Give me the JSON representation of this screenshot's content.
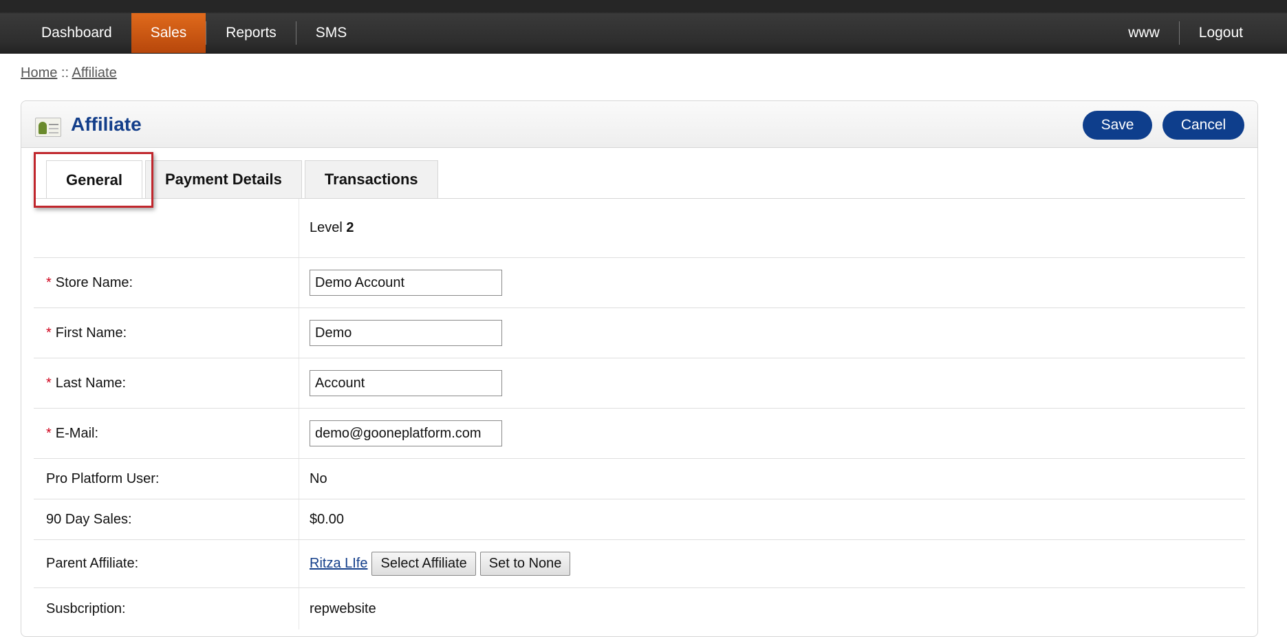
{
  "nav": {
    "left": [
      {
        "label": "Dashboard",
        "active": false
      },
      {
        "label": "Sales",
        "active": true
      },
      {
        "label": "Reports",
        "active": false
      },
      {
        "label": "SMS",
        "active": false
      }
    ],
    "right": [
      {
        "label": "www"
      },
      {
        "label": "Logout"
      }
    ],
    "active_color": "#d45a14"
  },
  "breadcrumb": {
    "home": "Home",
    "separator": "::",
    "current": "Affiliate"
  },
  "panel": {
    "icon": "id-card-icon",
    "title": "Affiliate",
    "save_label": "Save",
    "cancel_label": "Cancel",
    "primary_color": "#0e3e8c"
  },
  "tabs": [
    {
      "label": "General",
      "active": true
    },
    {
      "label": "Payment Details",
      "active": false
    },
    {
      "label": "Transactions",
      "active": false
    }
  ],
  "form": {
    "level_label": "Level",
    "level_value": "2",
    "required_mark": "*",
    "store_name": {
      "label": "Store Name:",
      "value": "Demo Account"
    },
    "first_name": {
      "label": "First Name:",
      "value": "Demo"
    },
    "last_name": {
      "label": "Last Name:",
      "value": "Account"
    },
    "email": {
      "label": "E-Mail:",
      "value": "demo@gooneplatform.com"
    },
    "pro_user": {
      "label": "Pro Platform User:",
      "value": "No"
    },
    "sales_90": {
      "label": "90 Day Sales:",
      "value": "$0.00"
    },
    "parent": {
      "label": "Parent Affiliate:",
      "link": "Ritza LIfe",
      "select_label": "Select Affiliate",
      "none_label": "Set to None"
    },
    "subscription": {
      "label": "Susbcription:",
      "value": "repwebsite"
    }
  }
}
